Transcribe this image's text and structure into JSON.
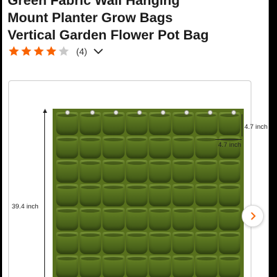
{
  "product": {
    "title_lines": [
      "Green Fabric Wall Hanging",
      "Mount Planter Grow Bags",
      "Vertical Garden Flower Pot Bag"
    ]
  },
  "rating": {
    "value": 4,
    "max": 5,
    "count_label": "(4)",
    "star_color": "#f96302",
    "empty_star_color": "#c8c8c8"
  },
  "image": {
    "dimensions": {
      "height_label": "39.4 inch",
      "pocket_height_label": "4.7 inch",
      "pocket_width_label": "4.7 inch"
    },
    "next_icon": "chevron-right-icon",
    "fabric_color": "#57701c"
  }
}
